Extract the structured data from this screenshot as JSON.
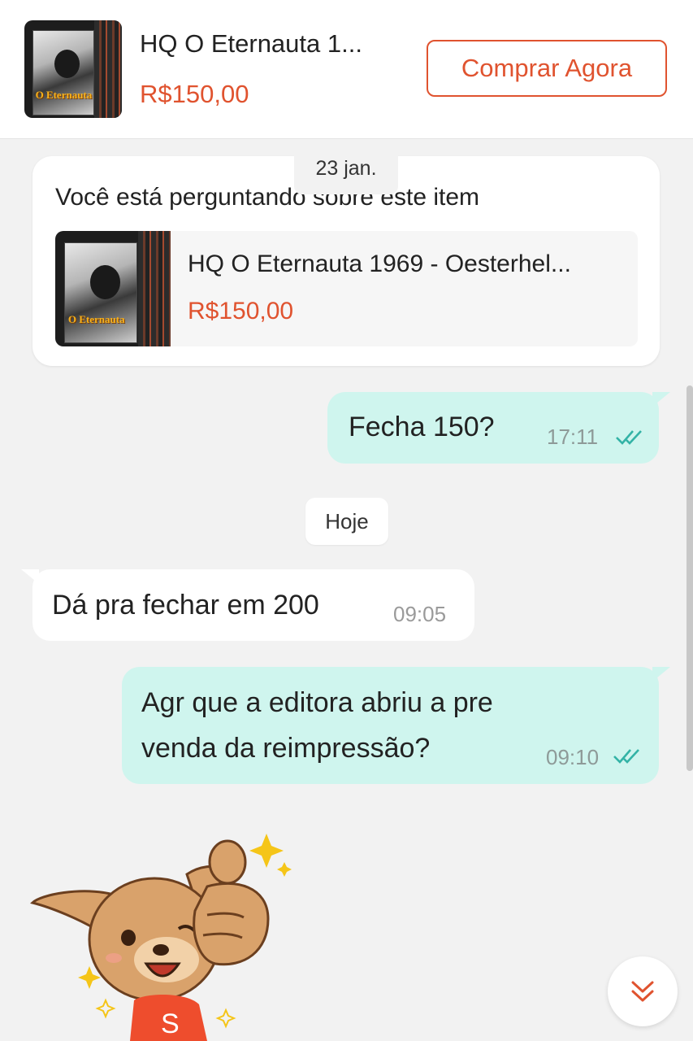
{
  "header": {
    "product_title": "HQ O Eternauta 1...",
    "product_price": "R$150,00",
    "buy_button_label": "Comprar Agora",
    "thumbnail_cover_text": "O Eternauta"
  },
  "product_card": {
    "heading": "Você está perguntando sobre este item",
    "date_chip": "23 jan.",
    "product_title": "HQ O Eternauta 1969 - Oesterhel...",
    "product_price": "R$150,00"
  },
  "messages": [
    {
      "direction": "out",
      "text": "Fecha 150?",
      "time": "17:11",
      "status_icon": "double-check-icon"
    },
    {
      "direction": "in",
      "text": "Dá pra fechar em 200",
      "time": "09:05"
    },
    {
      "direction": "out",
      "text": "Agr que a editora abriu a pre venda da reimpressão?",
      "time": "09:10",
      "status_icon": "double-check-icon"
    }
  ],
  "day_separator": "Hoje",
  "sticker": {
    "icon": "thumbs-up-dog-sticker",
    "badge_letter": "S"
  },
  "colors": {
    "accent": "#e0532f",
    "outgoing_bubble": "#cff5ee",
    "incoming_bubble": "#ffffff",
    "background": "#f2f2f2",
    "check_color": "#33b3a6"
  }
}
